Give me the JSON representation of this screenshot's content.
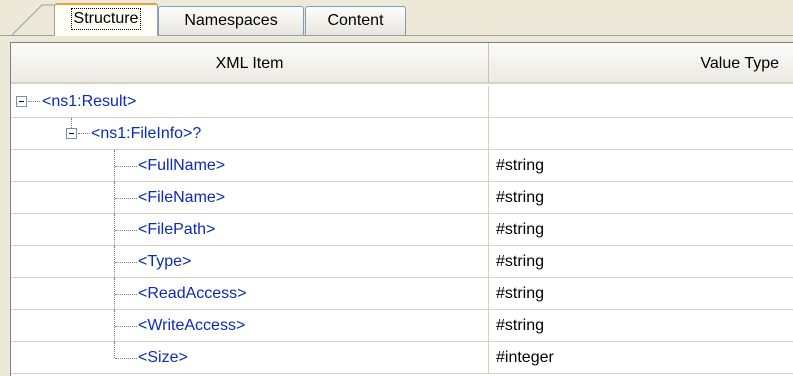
{
  "tabs": [
    {
      "label": "Structure",
      "active": true
    },
    {
      "label": "Namespaces",
      "active": false
    },
    {
      "label": "Content",
      "active": false
    }
  ],
  "table": {
    "columns": [
      "XML Item",
      "Value Type"
    ],
    "rows": [
      {
        "item": "<ns1:Result>",
        "value": ""
      },
      {
        "item": "<ns1:FileInfo>?",
        "value": ""
      },
      {
        "item": "<FullName>",
        "value": "#string"
      },
      {
        "item": "<FileName>",
        "value": "#string"
      },
      {
        "item": "<FilePath>",
        "value": "#string"
      },
      {
        "item": "<Type>",
        "value": "#string"
      },
      {
        "item": "<ReadAccess>",
        "value": "#string"
      },
      {
        "item": "<WriteAccess>",
        "value": "#string"
      },
      {
        "item": "<Size>",
        "value": "#integer"
      }
    ]
  },
  "colors": {
    "item_text": "#0a2bb5",
    "tab_accent": "#e9a13b"
  }
}
